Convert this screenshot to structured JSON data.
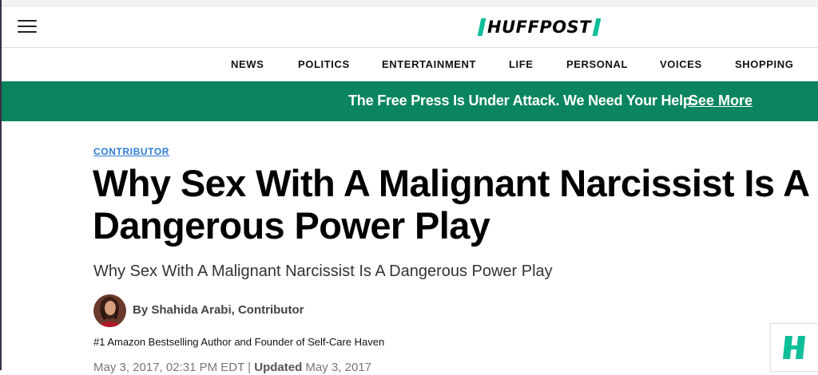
{
  "header": {
    "menu_icon": "hamburger-menu-icon",
    "logo_text": "HUFFPOST",
    "logo_accent_color": "#0dbe98"
  },
  "nav": {
    "items": [
      {
        "label": "NEWS"
      },
      {
        "label": "POLITICS"
      },
      {
        "label": "ENTERTAINMENT"
      },
      {
        "label": "LIFE"
      },
      {
        "label": "PERSONAL"
      },
      {
        "label": "VOICES"
      },
      {
        "label": "SHOPPING"
      }
    ]
  },
  "banner": {
    "text": "The Free Press Is Under Attack. We Need Your Help.",
    "link_label": "See More",
    "background_color": "#0a8560"
  },
  "article": {
    "kicker": "CONTRIBUTOR",
    "headline": "Why Sex With A Malignant Narcissist Is A Dangerous Power Play",
    "subheadline": "Why Sex With A Malignant Narcissist Is A Dangerous Power Play",
    "byline": "By Shahida Arabi, Contributor",
    "author_bio": "#1 Amazon Bestselling Author and Founder of Self-Care Haven",
    "published": "May 3, 2017, 02:31 PM EDT",
    "updated_label": "Updated",
    "updated": "May 3, 2017"
  },
  "floating_badge": {
    "icon": "huffpost-h-icon",
    "color": "#0dbe98"
  }
}
